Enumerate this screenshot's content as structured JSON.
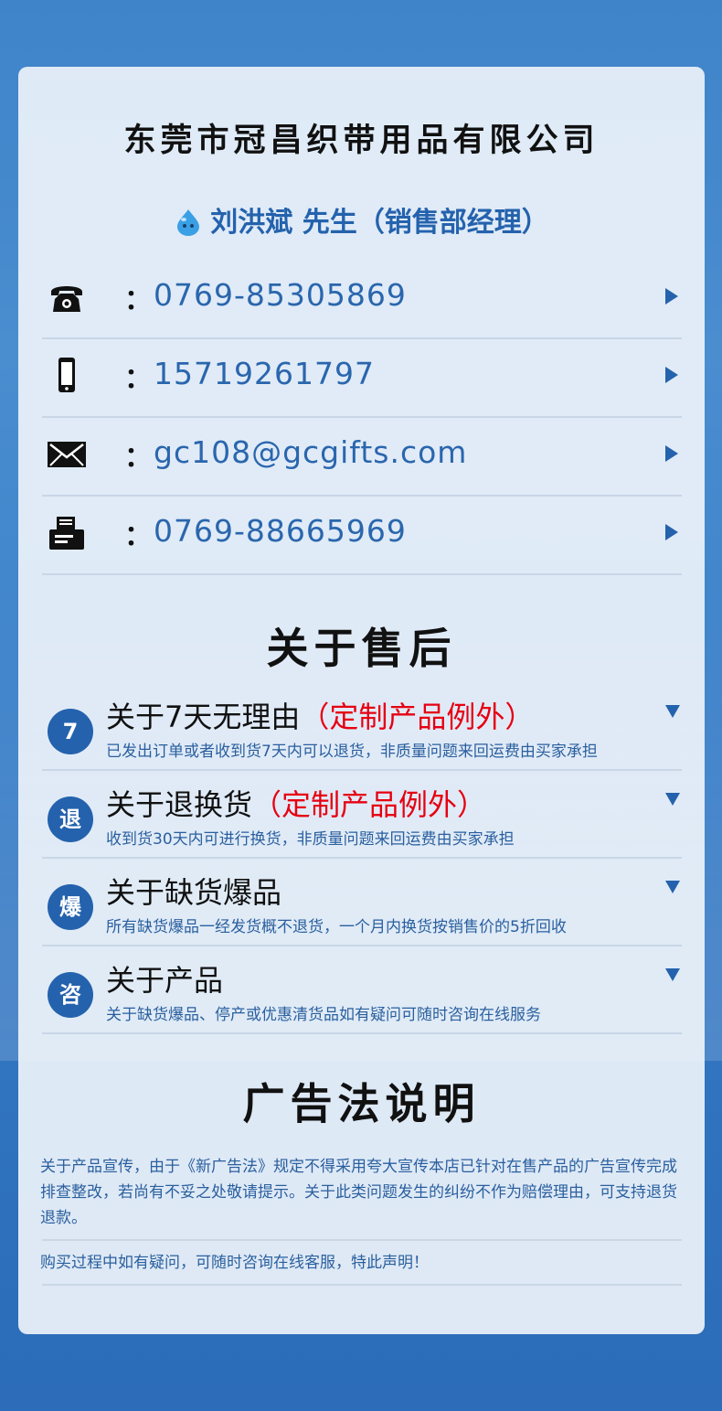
{
  "company": "东莞市冠昌织带用品有限公司",
  "contact_person": "刘洪斌 先生（销售部经理）",
  "contacts": [
    {
      "icon": "phone-icon",
      "colon": "：",
      "value": "0769-85305869"
    },
    {
      "icon": "mobile-icon",
      "colon": "：",
      "value": "15719261797"
    },
    {
      "icon": "mail-icon",
      "colon": "：",
      "value": "gc108@gcgifts.com"
    },
    {
      "icon": "fax-icon",
      "colon": "：",
      "value": "0769-88665969"
    }
  ],
  "after_sales": {
    "title": "关于售后",
    "items": [
      {
        "badge": "7",
        "title": "关于7天无理由",
        "note": "（定制产品例外）",
        "desc": "已发出订单或者收到货7天内可以退货，非质量问题来回运费由买家承担"
      },
      {
        "badge": "退",
        "title": "关于退换货",
        "note": "（定制产品例外）",
        "desc": "收到货30天内可进行换货，非质量问题来回运费由买家承担"
      },
      {
        "badge": "爆",
        "title": "关于缺货爆品",
        "note": "",
        "desc": "所有缺货爆品一经发货概不退货，一个月内换货按销售价的5折回收"
      },
      {
        "badge": "咨",
        "title": "关于产品",
        "note": "",
        "desc": "关于缺货爆品、停产或优惠清货品如有疑问可随时咨询在线服务"
      }
    ]
  },
  "ad_law": {
    "title": "广告法说明",
    "paragraph1": "关于产品宣传，由于《新广告法》规定不得采用夸大宣传本店已针对在售产品的广告宣传完成排查整改，若尚有不妥之处敬请提示。关于此类问题发生的纠纷不作为赔偿理由，可支持退货退款。",
    "paragraph2": "购买过程中如有疑问，可随时咨询在线客服，特此声明！"
  },
  "colors": {
    "accent": "#2462ad",
    "red": "#e60012",
    "desc": "#2a5f9e"
  }
}
